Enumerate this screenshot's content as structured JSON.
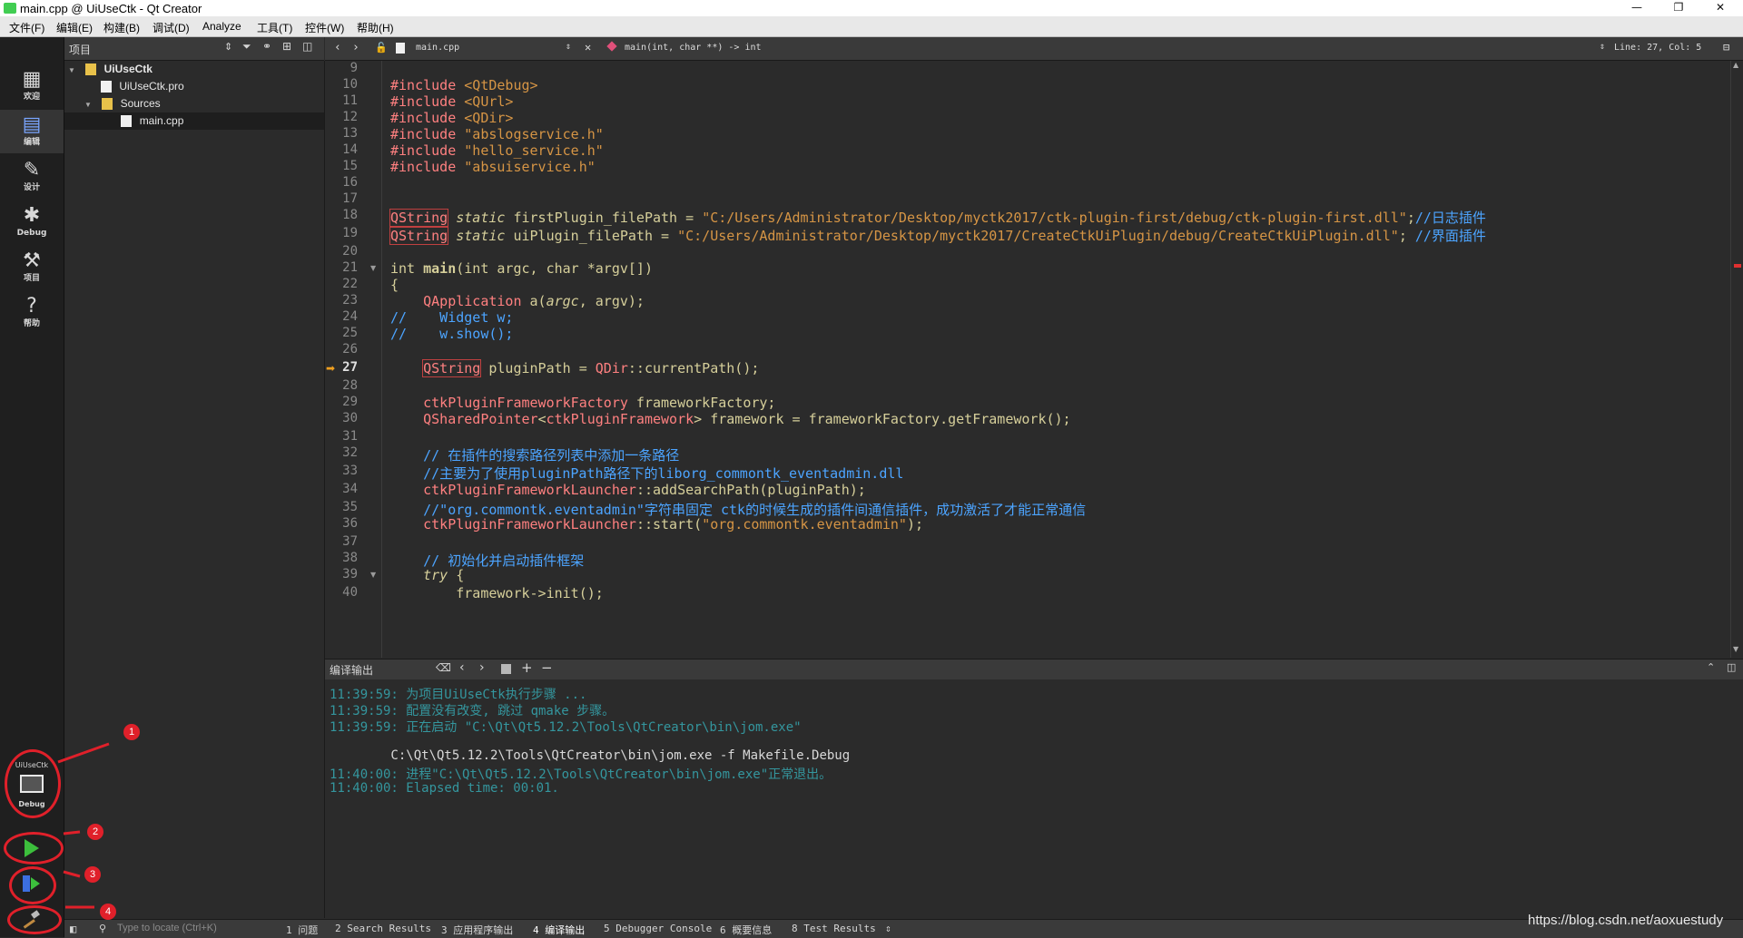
{
  "window": {
    "title": "main.cpp @ UiUseCtk - Qt Creator",
    "minimize": "—",
    "restore": "❐",
    "close": "✕"
  },
  "menubar": [
    "文件(F)",
    "编辑(E)",
    "构建(B)",
    "调试(D)",
    "Analyze",
    "工具(T)",
    "控件(W)",
    "帮助(H)"
  ],
  "modes": [
    {
      "label": "欢迎",
      "icon": "grid-icon"
    },
    {
      "label": "编辑",
      "icon": "edit-icon"
    },
    {
      "label": "设计",
      "icon": "pencil-icon"
    },
    {
      "label": "Debug",
      "icon": "bug-icon"
    },
    {
      "label": "项目",
      "icon": "wrench-icon"
    },
    {
      "label": "帮助",
      "icon": "help-icon"
    }
  ],
  "kit": {
    "project": "UiUseCtk",
    "config": "Debug"
  },
  "project_pane": {
    "title": "项目",
    "tree": [
      {
        "label": "UiUseCtk",
        "level": 0
      },
      {
        "label": "UiUseCtk.pro",
        "level": 1
      },
      {
        "label": "Sources",
        "level": 1
      },
      {
        "label": "main.cpp",
        "level": 2
      }
    ]
  },
  "editor": {
    "file": "main.cpp",
    "symbol": "main(int, char **) -> int",
    "position": "Line: 27, Col: 5",
    "current_line": 27,
    "lines": [
      {
        "n": 9,
        "segs": []
      },
      {
        "n": 10,
        "segs": [
          [
            "inc",
            "#include "
          ],
          [
            "str",
            "<QtDebug>"
          ]
        ]
      },
      {
        "n": 11,
        "segs": [
          [
            "inc",
            "#include "
          ],
          [
            "str",
            "<QUrl>"
          ]
        ]
      },
      {
        "n": 12,
        "segs": [
          [
            "inc",
            "#include "
          ],
          [
            "str",
            "<QDir>"
          ]
        ]
      },
      {
        "n": 13,
        "segs": [
          [
            "inc",
            "#include "
          ],
          [
            "str",
            "\"abslogservice.h\""
          ]
        ]
      },
      {
        "n": 14,
        "segs": [
          [
            "inc",
            "#include "
          ],
          [
            "str",
            "\"hello_service.h\""
          ]
        ]
      },
      {
        "n": 15,
        "segs": [
          [
            "inc",
            "#include "
          ],
          [
            "str",
            "\"absuiservice.h\""
          ]
        ]
      },
      {
        "n": 16,
        "segs": []
      },
      {
        "n": 17,
        "segs": []
      },
      {
        "n": 18,
        "segs": [
          [
            "typebox",
            "QString"
          ],
          [
            "plain",
            " "
          ],
          [
            "italic",
            "static"
          ],
          [
            "plain",
            " firstPlugin_filePath = "
          ],
          [
            "str",
            "\"C:/Users/Administrator/Desktop/myctk2017/ctk-plugin-first/debug/ctk-plugin-first.dll\""
          ],
          [
            "plain",
            ";"
          ],
          [
            "cmt",
            "//日志插件"
          ]
        ]
      },
      {
        "n": 19,
        "segs": [
          [
            "typebox",
            "QString"
          ],
          [
            "plain",
            " "
          ],
          [
            "italic",
            "static"
          ],
          [
            "plain",
            " uiPlugin_filePath = "
          ],
          [
            "str",
            "\"C:/Users/Administrator/Desktop/myctk2017/CreateCtkUiPlugin/debug/CreateCtkUiPlugin.dll\""
          ],
          [
            "plain",
            "; "
          ],
          [
            "cmt",
            "//界面插件"
          ]
        ]
      },
      {
        "n": 20,
        "segs": []
      },
      {
        "n": 21,
        "segs": [
          [
            "plain",
            "int "
          ],
          [
            "fn",
            "main"
          ],
          [
            "plain",
            "(int argc, char *argv[])"
          ]
        ],
        "fold": true
      },
      {
        "n": 22,
        "segs": [
          [
            "plain",
            "{"
          ]
        ]
      },
      {
        "n": 23,
        "segs": [
          [
            "plain",
            "    "
          ],
          [
            "type",
            "QApplication"
          ],
          [
            "plain",
            " a("
          ],
          [
            "italic",
            "argc"
          ],
          [
            "plain",
            ", argv);"
          ]
        ]
      },
      {
        "n": 24,
        "segs": [
          [
            "cmt",
            "//    Widget w;"
          ]
        ]
      },
      {
        "n": 25,
        "segs": [
          [
            "cmt",
            "//    w.show();"
          ]
        ]
      },
      {
        "n": 26,
        "segs": []
      },
      {
        "n": 27,
        "segs": [
          [
            "plain",
            "    "
          ],
          [
            "typebox",
            "QString"
          ],
          [
            "plain",
            " pluginPath = "
          ],
          [
            "type",
            "QDir"
          ],
          [
            "plain",
            "::currentPath();"
          ]
        ]
      },
      {
        "n": 28,
        "segs": []
      },
      {
        "n": 29,
        "segs": [
          [
            "plain",
            "    "
          ],
          [
            "type",
            "ctkPluginFrameworkFactory"
          ],
          [
            "plain",
            " frameworkFactory;"
          ]
        ]
      },
      {
        "n": 30,
        "segs": [
          [
            "plain",
            "    "
          ],
          [
            "type",
            "QSharedPointer"
          ],
          [
            "plain",
            "<"
          ],
          [
            "type",
            "ctkPluginFramework"
          ],
          [
            "plain",
            "> framework = frameworkFactory.getFramework();"
          ]
        ]
      },
      {
        "n": 31,
        "segs": []
      },
      {
        "n": 32,
        "segs": [
          [
            "plain",
            "    "
          ],
          [
            "cmt",
            "// 在插件的搜索路径列表中添加一条路径"
          ]
        ]
      },
      {
        "n": 33,
        "segs": [
          [
            "plain",
            "    "
          ],
          [
            "cmt",
            "//主要为了使用pluginPath路径下的liborg_commontk_eventadmin.dll"
          ]
        ]
      },
      {
        "n": 34,
        "segs": [
          [
            "plain",
            "    "
          ],
          [
            "type",
            "ctkPluginFrameworkLauncher"
          ],
          [
            "plain",
            "::addSearchPath(pluginPath);"
          ]
        ]
      },
      {
        "n": 35,
        "segs": [
          [
            "plain",
            "    "
          ],
          [
            "cmt",
            "//\"org.commontk.eventadmin\"字符串固定 ctk的时候生成的插件间通信插件，成功激活了才能正常通信"
          ]
        ]
      },
      {
        "n": 36,
        "segs": [
          [
            "plain",
            "    "
          ],
          [
            "type",
            "ctkPluginFrameworkLauncher"
          ],
          [
            "plain",
            "::start("
          ],
          [
            "str",
            "\"org.commontk.eventadmin\""
          ],
          [
            "plain",
            ");"
          ]
        ]
      },
      {
        "n": 37,
        "segs": []
      },
      {
        "n": 38,
        "segs": [
          [
            "plain",
            "    "
          ],
          [
            "cmt",
            "// 初始化并启动插件框架"
          ]
        ]
      },
      {
        "n": 39,
        "segs": [
          [
            "plain",
            "    "
          ],
          [
            "italic",
            "try"
          ],
          [
            "plain",
            " {"
          ]
        ],
        "fold": true
      },
      {
        "n": 40,
        "segs": [
          [
            "plain",
            "        framework->init();"
          ]
        ]
      }
    ]
  },
  "output": {
    "title": "编译输出",
    "lines": [
      {
        "text": "11:39:59: 为项目UiUseCtk执行步骤 ...",
        "kind": "info"
      },
      {
        "text": "11:39:59: 配置没有改变, 跳过 qmake 步骤。",
        "kind": "info"
      },
      {
        "text": "11:39:59: 正在启动 \"C:\\Qt\\Qt5.12.2\\Tools\\QtCreator\\bin\\jom.exe\"",
        "kind": "info"
      },
      {
        "text": "",
        "kind": "blank"
      },
      {
        "text": "        C:\\Qt\\Qt5.12.2\\Tools\\QtCreator\\bin\\jom.exe -f Makefile.Debug",
        "kind": "norm"
      },
      {
        "text": "11:40:00: 进程\"C:\\Qt\\Qt5.12.2\\Tools\\QtCreator\\bin\\jom.exe\"正常退出。",
        "kind": "info"
      },
      {
        "text": "11:40:00: Elapsed time: 00:01.",
        "kind": "info"
      }
    ]
  },
  "statusbar": {
    "locate_placeholder": "Type to locate (Ctrl+K)",
    "tabs": [
      "1 问题",
      "2 Search Results",
      "3 应用程序输出",
      "4 编译输出",
      "5 Debugger Console",
      "6 概要信息",
      "8 Test Results"
    ],
    "watermark": "https://blog.csdn.net/aoxuestudy"
  },
  "annotations": [
    "1",
    "2",
    "3",
    "4"
  ],
  "colors": {
    "accent_red": "#e0202a",
    "run_green": "#3cbf3c"
  }
}
